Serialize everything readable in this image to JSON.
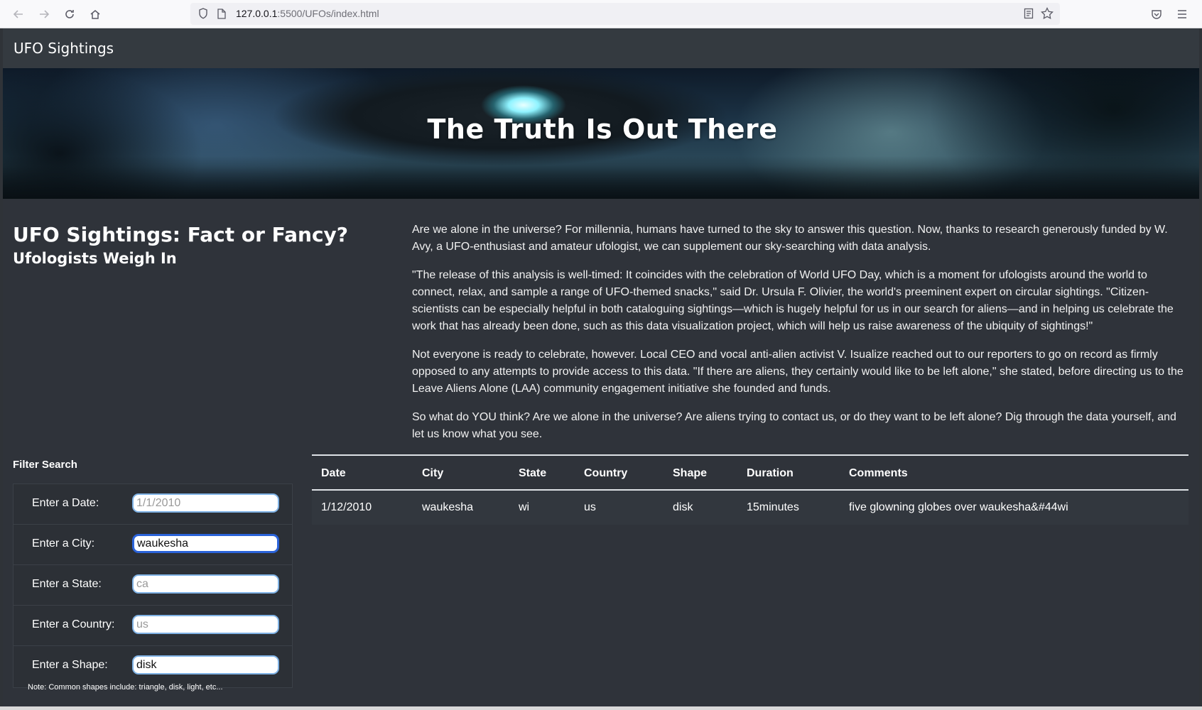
{
  "browser": {
    "url_host": "127.0.0.1",
    "url_rest": ":5500/UFOs/index.html"
  },
  "navbar": {
    "brand": "UFO Sightings"
  },
  "hero": {
    "title": "The Truth Is Out There"
  },
  "intro": {
    "headline": "UFO Sightings: Fact or Fancy?",
    "subhead": "Ufologists Weigh In"
  },
  "article": {
    "paragraphs": [
      "Are we alone in the universe? For millennia, humans have turned to the sky to answer this question. Now, thanks to research generously funded by W. Avy, a UFO-enthusiast and amateur ufologist, we can supplement our sky-searching with data analysis.",
      "\"The release of this analysis is well-timed: It coincides with the celebration of World UFO Day, which is a moment for ufologists around the world to connect, relax, and sample a range of UFO-themed snacks,\" said Dr. Ursula F. Olivier, the world's preeminent expert on circular sightings. \"Citizen-scientists can be especially helpful in both cataloguing sightings—which is hugely helpful for us in our search for aliens—and in helping us celebrate the work that has already been done, such as this data visualization project, which will help us raise awareness of the ubiquity of sightings!\"",
      "Not everyone is ready to celebrate, however. Local CEO and vocal anti-alien activist V. Isualize reached out to our reporters to go on record as firmly opposed to any attempts to provide access to this data. \"If there are aliens, they certainly would like to be left alone,\" she stated, before directing us to the Leave Aliens Alone (LAA) community engagement initiative she founded and funds.",
      "So what do YOU think? Are we alone in the universe? Are aliens trying to contact us, or do they want to be left alone? Dig through the data yourself, and let us know what you see."
    ]
  },
  "filters": {
    "title": "Filter Search",
    "items": [
      {
        "label": "Enter a Date:",
        "value": "",
        "placeholder": "1/1/2010"
      },
      {
        "label": "Enter a City:",
        "value": "waukesha",
        "placeholder": ""
      },
      {
        "label": "Enter a State:",
        "value": "",
        "placeholder": "ca"
      },
      {
        "label": "Enter a Country:",
        "value": "",
        "placeholder": "us"
      },
      {
        "label": "Enter a Shape:",
        "value": "disk",
        "placeholder": ""
      }
    ],
    "note": "Note: Common shapes include: triangle, disk, light, etc..."
  },
  "table": {
    "headers": [
      "Date",
      "City",
      "State",
      "Country",
      "Shape",
      "Duration",
      "Comments"
    ],
    "rows": [
      [
        "1/12/2010",
        "waukesha",
        "wi",
        "us",
        "disk",
        "15minutes",
        "five glowning globes over waukesha&#44wi"
      ]
    ]
  }
}
